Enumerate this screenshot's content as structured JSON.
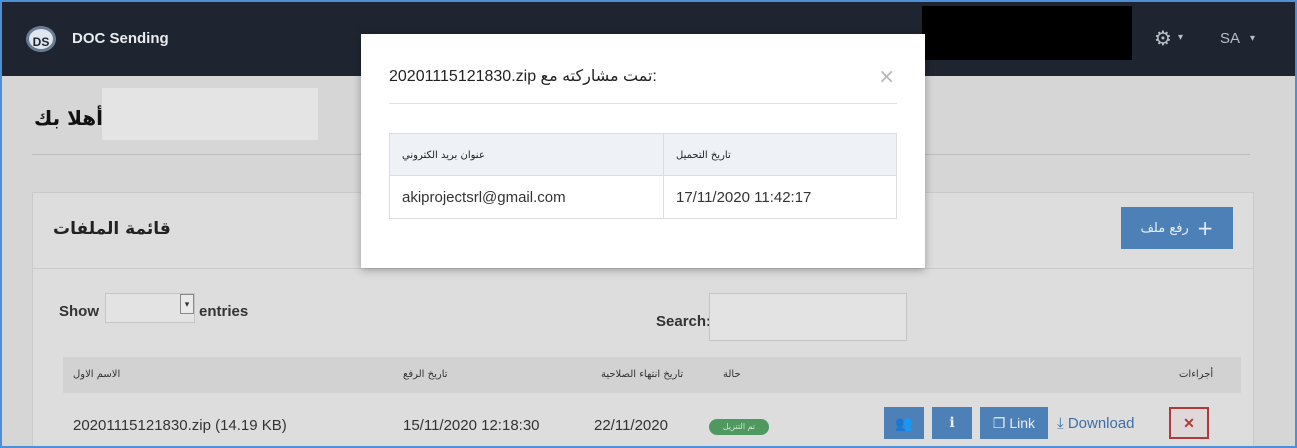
{
  "navbar": {
    "logo_text": "DS",
    "brand": "DOC Sending",
    "user": "SA"
  },
  "page": {
    "welcome": "أهلا بك"
  },
  "files_card": {
    "title": "قائمة الملفات",
    "upload_label": "رفع ملف",
    "show_label": "Show",
    "entries_label": "entries",
    "search_label": "Search:",
    "columns": [
      "الاسم الاول",
      "تاريخ الرفع",
      "تاريخ انتهاء الصلاحية",
      "حالة",
      "أجراءات"
    ],
    "rows": [
      {
        "name": "20201115121830.zip (14.19 KB)",
        "uploaded": "15/11/2020 12:18:30",
        "expires": "22/11/2020",
        "status": "تم التنزيل",
        "actions": {
          "link_label": "Link",
          "download_label": "Download"
        }
      }
    ]
  },
  "modal": {
    "title": "20201115121830.zip تمت مشاركته مع:",
    "columns": [
      "عنوان بريد الكتروني",
      "تاريخ التحميل"
    ],
    "rows": [
      {
        "email": "akiprojectsrl@gmail.com",
        "date": "17/11/2020 11:42:17"
      }
    ]
  },
  "colors": {
    "navbar": "#1f2530",
    "primary_button": "#4e80b8",
    "status_badge": "#4f9960",
    "delete": "#b03a3a"
  }
}
